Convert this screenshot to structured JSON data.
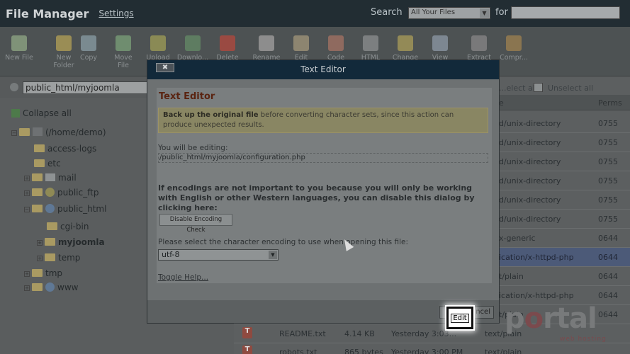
{
  "header": {
    "title": "File Manager",
    "settings": "Settings",
    "search_label": "Search",
    "search_scope": "All Your Files",
    "for_label": "for",
    "search_value": ""
  },
  "toolbar": [
    {
      "label": "New File",
      "icon": "new-file-icon"
    },
    {
      "label": "New\nFolder",
      "icon": "new-folder-icon"
    },
    {
      "label": "Copy",
      "icon": "copy-icon"
    },
    {
      "label": "Move\nFile",
      "icon": "move-file-icon"
    },
    {
      "label": "Upload",
      "icon": "upload-icon"
    },
    {
      "label": "Downlo...",
      "icon": "download-icon"
    },
    {
      "label": "Delete",
      "icon": "delete-icon"
    },
    {
      "label": "Rename",
      "icon": "rename-icon"
    },
    {
      "label": "Edit",
      "icon": "edit-icon"
    },
    {
      "label": "Code",
      "icon": "code-icon"
    },
    {
      "label": "HTML",
      "icon": "html-icon"
    },
    {
      "label": "Change",
      "icon": "change-icon"
    },
    {
      "label": "View",
      "icon": "view-icon"
    },
    {
      "label": "Extract",
      "icon": "extract-icon"
    },
    {
      "label": "Compr...",
      "icon": "compress-icon"
    }
  ],
  "path": {
    "value": "public_html/myjoomla"
  },
  "tree": {
    "collapse_all": "Collapse all",
    "root": "(/home/demo)",
    "items": [
      "access-logs",
      "etc",
      "mail",
      "public_ftp",
      "public_html",
      "cgi-bin",
      "myjoomla",
      "temp",
      "tmp",
      "www"
    ]
  },
  "list": {
    "select_all": "...elect all",
    "unselect_all": "Unselect all",
    "col_type": "e",
    "col_perms": "Perms",
    "rows": [
      {
        "type": "d/unix-directory",
        "perms": "0755"
      },
      {
        "type": "d/unix-directory",
        "perms": "0755"
      },
      {
        "type": "d/unix-directory",
        "perms": "0755"
      },
      {
        "type": "d/unix-directory",
        "perms": "0755"
      },
      {
        "type": "d/unix-directory",
        "perms": "0755"
      },
      {
        "type": "d/unix-directory",
        "perms": "0755"
      },
      {
        "type": "x-generic",
        "perms": "0644"
      },
      {
        "type": "ication/x-httpd-php",
        "perms": "0644"
      },
      {
        "type": "t/plain",
        "perms": "0644"
      },
      {
        "type": "ication/x-httpd-php",
        "perms": "0644"
      },
      {
        "type": "t/plain",
        "perms": "0644"
      }
    ],
    "bottom_rows": [
      {
        "name": "README.txt",
        "size": "4.14 KB",
        "date": "Yesterday 3:03...",
        "type": "text/plain"
      },
      {
        "name": "robots.txt",
        "size": "865 bytes",
        "date": "Yesterday 3:00 PM",
        "type": "text/plain"
      }
    ]
  },
  "dialog": {
    "title": "Text Editor",
    "close": "✖",
    "heading": "Text Editor",
    "warn_bold": "Back up the original file",
    "warn_rest": " before converting character sets, since this action can produce unexpected results.",
    "editing_label": "You will be editing:",
    "editing_path": "/public_html/myjoomla/configuration.php",
    "encoding_note": "If encodings are not important to you because you will only be working with English or other Western languages, you can disable this dialog by clicking here:",
    "disable_btn": "Disable Encoding Check",
    "select_label": "Please select the character encoding to use when opening this file:",
    "encoding": "utf-8",
    "toggle_help": "Toggle Help...",
    "cancel": "ncel",
    "edit": "Edit"
  },
  "watermark": {
    "brand_a": "p",
    "brand_o": "o",
    "brand_b": "rtal",
    "sub": "web hosting"
  }
}
